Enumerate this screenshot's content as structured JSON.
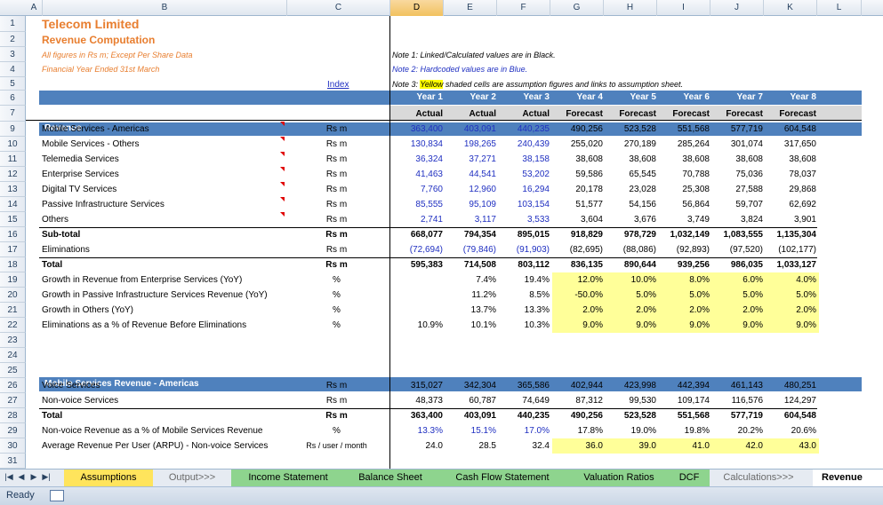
{
  "columns": [
    "A",
    "B",
    "C",
    "D",
    "E",
    "F",
    "G",
    "H",
    "I",
    "J",
    "K",
    "L"
  ],
  "selected_column": "D",
  "rows": [
    "1",
    "2",
    "3",
    "4",
    "5",
    "6",
    "7",
    "9",
    "10",
    "11",
    "12",
    "13",
    "14",
    "15",
    "16",
    "17",
    "18",
    "19",
    "20",
    "21",
    "22",
    "23",
    "24",
    "25",
    "26",
    "27",
    "28",
    "29",
    "30",
    "31"
  ],
  "header": {
    "company": "Telecom Limited",
    "subtitle": "Revenue Computation",
    "figures_note": "All figures in Rs m; Except Per Share Data",
    "fy_note": "Financial Year Ended 31st March",
    "index_link": "Index",
    "note1": "Note 1: Linked/Calculated values are in Black.",
    "note2": "Note 2: Hardcoded values are in Blue.",
    "note3_prefix": "Note 3: ",
    "note3_highlight": "Yellow",
    "note3_suffix": " shaded cells are assumption figures and links to assumption sheet."
  },
  "years": [
    "Year 1",
    "Year 2",
    "Year 3",
    "Year 4",
    "Year 5",
    "Year 6",
    "Year 7",
    "Year 8"
  ],
  "types": [
    "Actual",
    "Actual",
    "Actual",
    "Forecast",
    "Forecast",
    "Forecast",
    "Forecast",
    "Forecast"
  ],
  "section1_title": "Revenue",
  "revenue_rows": [
    {
      "label": "Mobile Services - Americas",
      "unit": "Rs m",
      "values": [
        "363,400",
        "403,091",
        "440,235",
        "490,256",
        "523,528",
        "551,568",
        "577,719",
        "604,548"
      ]
    },
    {
      "label": "Mobile Services - Others",
      "unit": "Rs m",
      "values": [
        "130,834",
        "198,265",
        "240,439",
        "255,020",
        "270,189",
        "285,264",
        "301,074",
        "317,650"
      ]
    },
    {
      "label": "Telemedia Services",
      "unit": "Rs m",
      "values": [
        "36,324",
        "37,271",
        "38,158",
        "38,608",
        "38,608",
        "38,608",
        "38,608",
        "38,608"
      ]
    },
    {
      "label": "Enterprise Services",
      "unit": "Rs m",
      "values": [
        "41,463",
        "44,541",
        "53,202",
        "59,586",
        "65,545",
        "70,788",
        "75,036",
        "78,037"
      ]
    },
    {
      "label": "Digital TV Services",
      "unit": "Rs m",
      "values": [
        "7,760",
        "12,960",
        "16,294",
        "20,178",
        "23,028",
        "25,308",
        "27,588",
        "29,868"
      ]
    },
    {
      "label": "Passive Infrastructure Services",
      "unit": "Rs m",
      "values": [
        "85,555",
        "95,109",
        "103,154",
        "51,577",
        "54,156",
        "56,864",
        "59,707",
        "62,692"
      ]
    },
    {
      "label": "Others",
      "unit": "Rs m",
      "values": [
        "2,741",
        "3,117",
        "3,533",
        "3,604",
        "3,676",
        "3,749",
        "3,824",
        "3,901"
      ]
    }
  ],
  "subtotal": {
    "label": "Sub-total",
    "unit": "Rs m",
    "values": [
      "668,077",
      "794,354",
      "895,015",
      "918,829",
      "978,729",
      "1,032,149",
      "1,083,555",
      "1,135,304"
    ]
  },
  "eliminations": {
    "label": "Eliminations",
    "unit": "Rs m",
    "values": [
      "(72,694)",
      "(79,846)",
      "(91,903)",
      "(82,695)",
      "(88,086)",
      "(92,893)",
      "(97,520)",
      "(102,177)"
    ]
  },
  "total": {
    "label": "Total",
    "unit": "Rs m",
    "values": [
      "595,383",
      "714,508",
      "803,112",
      "836,135",
      "890,644",
      "939,256",
      "986,035",
      "1,033,127"
    ]
  },
  "growth_rows": [
    {
      "label": "Growth in Revenue from Enterprise Services (YoY)",
      "unit": "%",
      "values": [
        "",
        "7.4%",
        "19.4%",
        "12.0%",
        "10.0%",
        "8.0%",
        "6.0%",
        "4.0%"
      ]
    },
    {
      "label": "Growth in Passive Infrastructure Services Revenue (YoY)",
      "unit": "%",
      "values": [
        "",
        "11.2%",
        "8.5%",
        "-50.0%",
        "5.0%",
        "5.0%",
        "5.0%",
        "5.0%"
      ]
    },
    {
      "label": "Growth in Others (YoY)",
      "unit": "%",
      "values": [
        "",
        "13.7%",
        "13.3%",
        "2.0%",
        "2.0%",
        "2.0%",
        "2.0%",
        "2.0%"
      ]
    },
    {
      "label": "Eliminations as a % of Revenue Before Eliminations",
      "unit": "%",
      "values": [
        "10.9%",
        "10.1%",
        "10.3%",
        "9.0%",
        "9.0%",
        "9.0%",
        "9.0%",
        "9.0%"
      ]
    }
  ],
  "section2_title": "Mobile Services Revenue - Americas",
  "mobile_rows": [
    {
      "label": "Voice Services",
      "unit": "Rs m",
      "values": [
        "315,027",
        "342,304",
        "365,586",
        "402,944",
        "423,998",
        "442,394",
        "461,143",
        "480,251"
      ]
    },
    {
      "label": "Non-voice Services",
      "unit": "Rs m",
      "values": [
        "48,373",
        "60,787",
        "74,649",
        "87,312",
        "99,530",
        "109,174",
        "116,576",
        "124,297"
      ]
    }
  ],
  "mobile_total": {
    "label": "Total",
    "unit": "Rs m",
    "values": [
      "363,400",
      "403,091",
      "440,235",
      "490,256",
      "523,528",
      "551,568",
      "577,719",
      "604,548"
    ]
  },
  "nonvoice_pct": {
    "label": "Non-voice Revenue as a % of Mobile Services Revenue",
    "unit": "%",
    "values": [
      "13.3%",
      "15.1%",
      "17.0%",
      "17.8%",
      "19.0%",
      "19.8%",
      "20.2%",
      "20.6%"
    ]
  },
  "arpu": {
    "label": "Average Revenue Per User (ARPU) - Non-voice Services",
    "unit": "Rs / user / month",
    "values": [
      "24.0",
      "28.5",
      "32.4",
      "36.0",
      "39.0",
      "41.0",
      "42.0",
      "43.0"
    ]
  },
  "tabs": [
    "Assumptions",
    "Output>>>",
    "Income Statement",
    "Balance Sheet",
    "Cash Flow Statement",
    "Valuation Ratios",
    "DCF",
    "Calculations>>>",
    "Revenue Co"
  ],
  "status": "Ready"
}
